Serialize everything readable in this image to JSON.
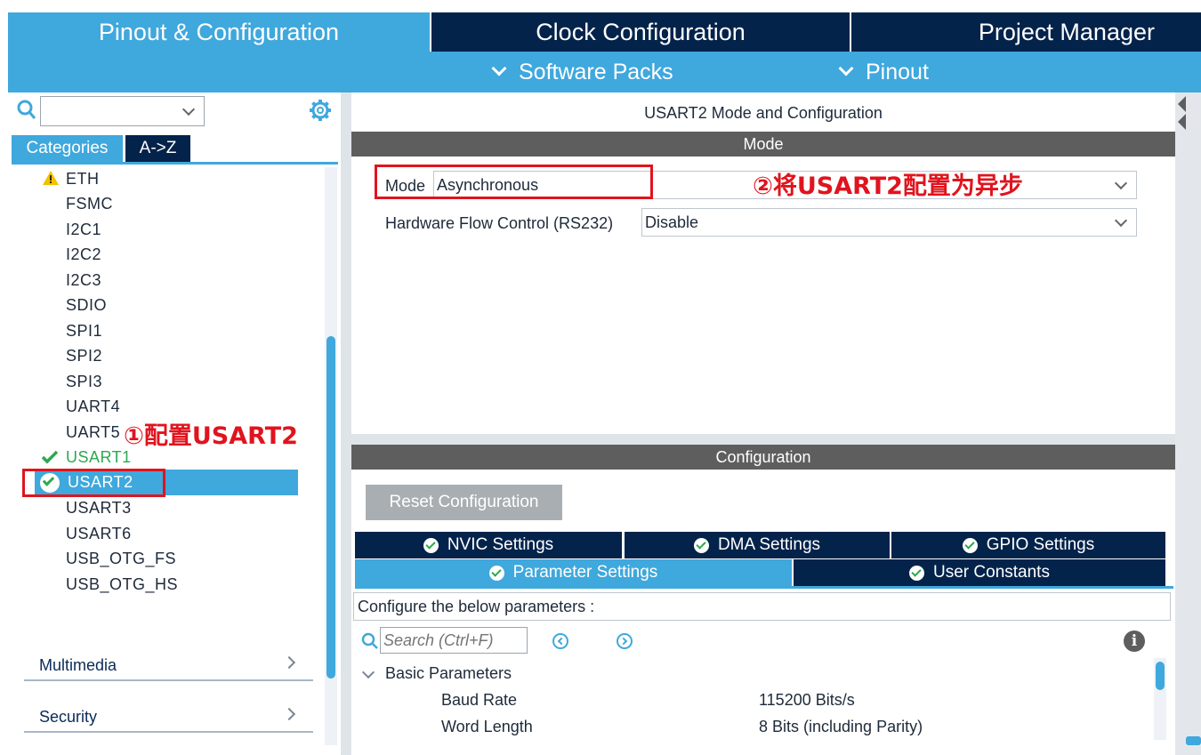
{
  "top_tabs": {
    "pinout": "Pinout & Configuration",
    "clock": "Clock Configuration",
    "project": "Project Manager"
  },
  "subbar": {
    "software_packs": "Software Packs",
    "pinout": "Pinout"
  },
  "left_panel": {
    "search_value": "",
    "tabs": {
      "categories": "Categories",
      "az": "A->Z"
    },
    "items": [
      "ETH",
      "FSMC",
      "I2C1",
      "I2C2",
      "I2C3",
      "SDIO",
      "SPI1",
      "SPI2",
      "SPI3",
      "UART4",
      "UART5",
      "USART1",
      "USART2",
      "USART3",
      "USART6",
      "USB_OTG_FS",
      "USB_OTG_HS"
    ],
    "groups": {
      "multimedia": "Multimedia",
      "security": "Security"
    }
  },
  "annotations": {
    "step1": "①配置USART2",
    "step2": "②将USART2配置为异步"
  },
  "mode_panel": {
    "title": "USART2 Mode and Configuration",
    "header": "Mode",
    "mode_label": "Mode",
    "mode_value": "Asynchronous",
    "hw_label": "Hardware Flow Control (RS232)",
    "hw_value": "Disable"
  },
  "config_panel": {
    "header": "Configuration",
    "reset_button": "Reset Configuration",
    "tabs": {
      "nvic": "NVIC Settings",
      "dma": "DMA Settings",
      "gpio": "GPIO Settings",
      "params": "Parameter Settings",
      "user": "User Constants"
    },
    "description": "Configure the below parameters :",
    "search_placeholder": "Search (Ctrl+F)",
    "section": "Basic Parameters",
    "params": [
      {
        "name": "Baud Rate",
        "value": "115200 Bits/s"
      },
      {
        "name": "Word Length",
        "value": "8 Bits (including Parity)"
      }
    ]
  },
  "colors": {
    "navy": "#03234b",
    "accent": "#3fa8dd",
    "annotation": "#e0141e",
    "ok_green": "#2ea84f"
  }
}
